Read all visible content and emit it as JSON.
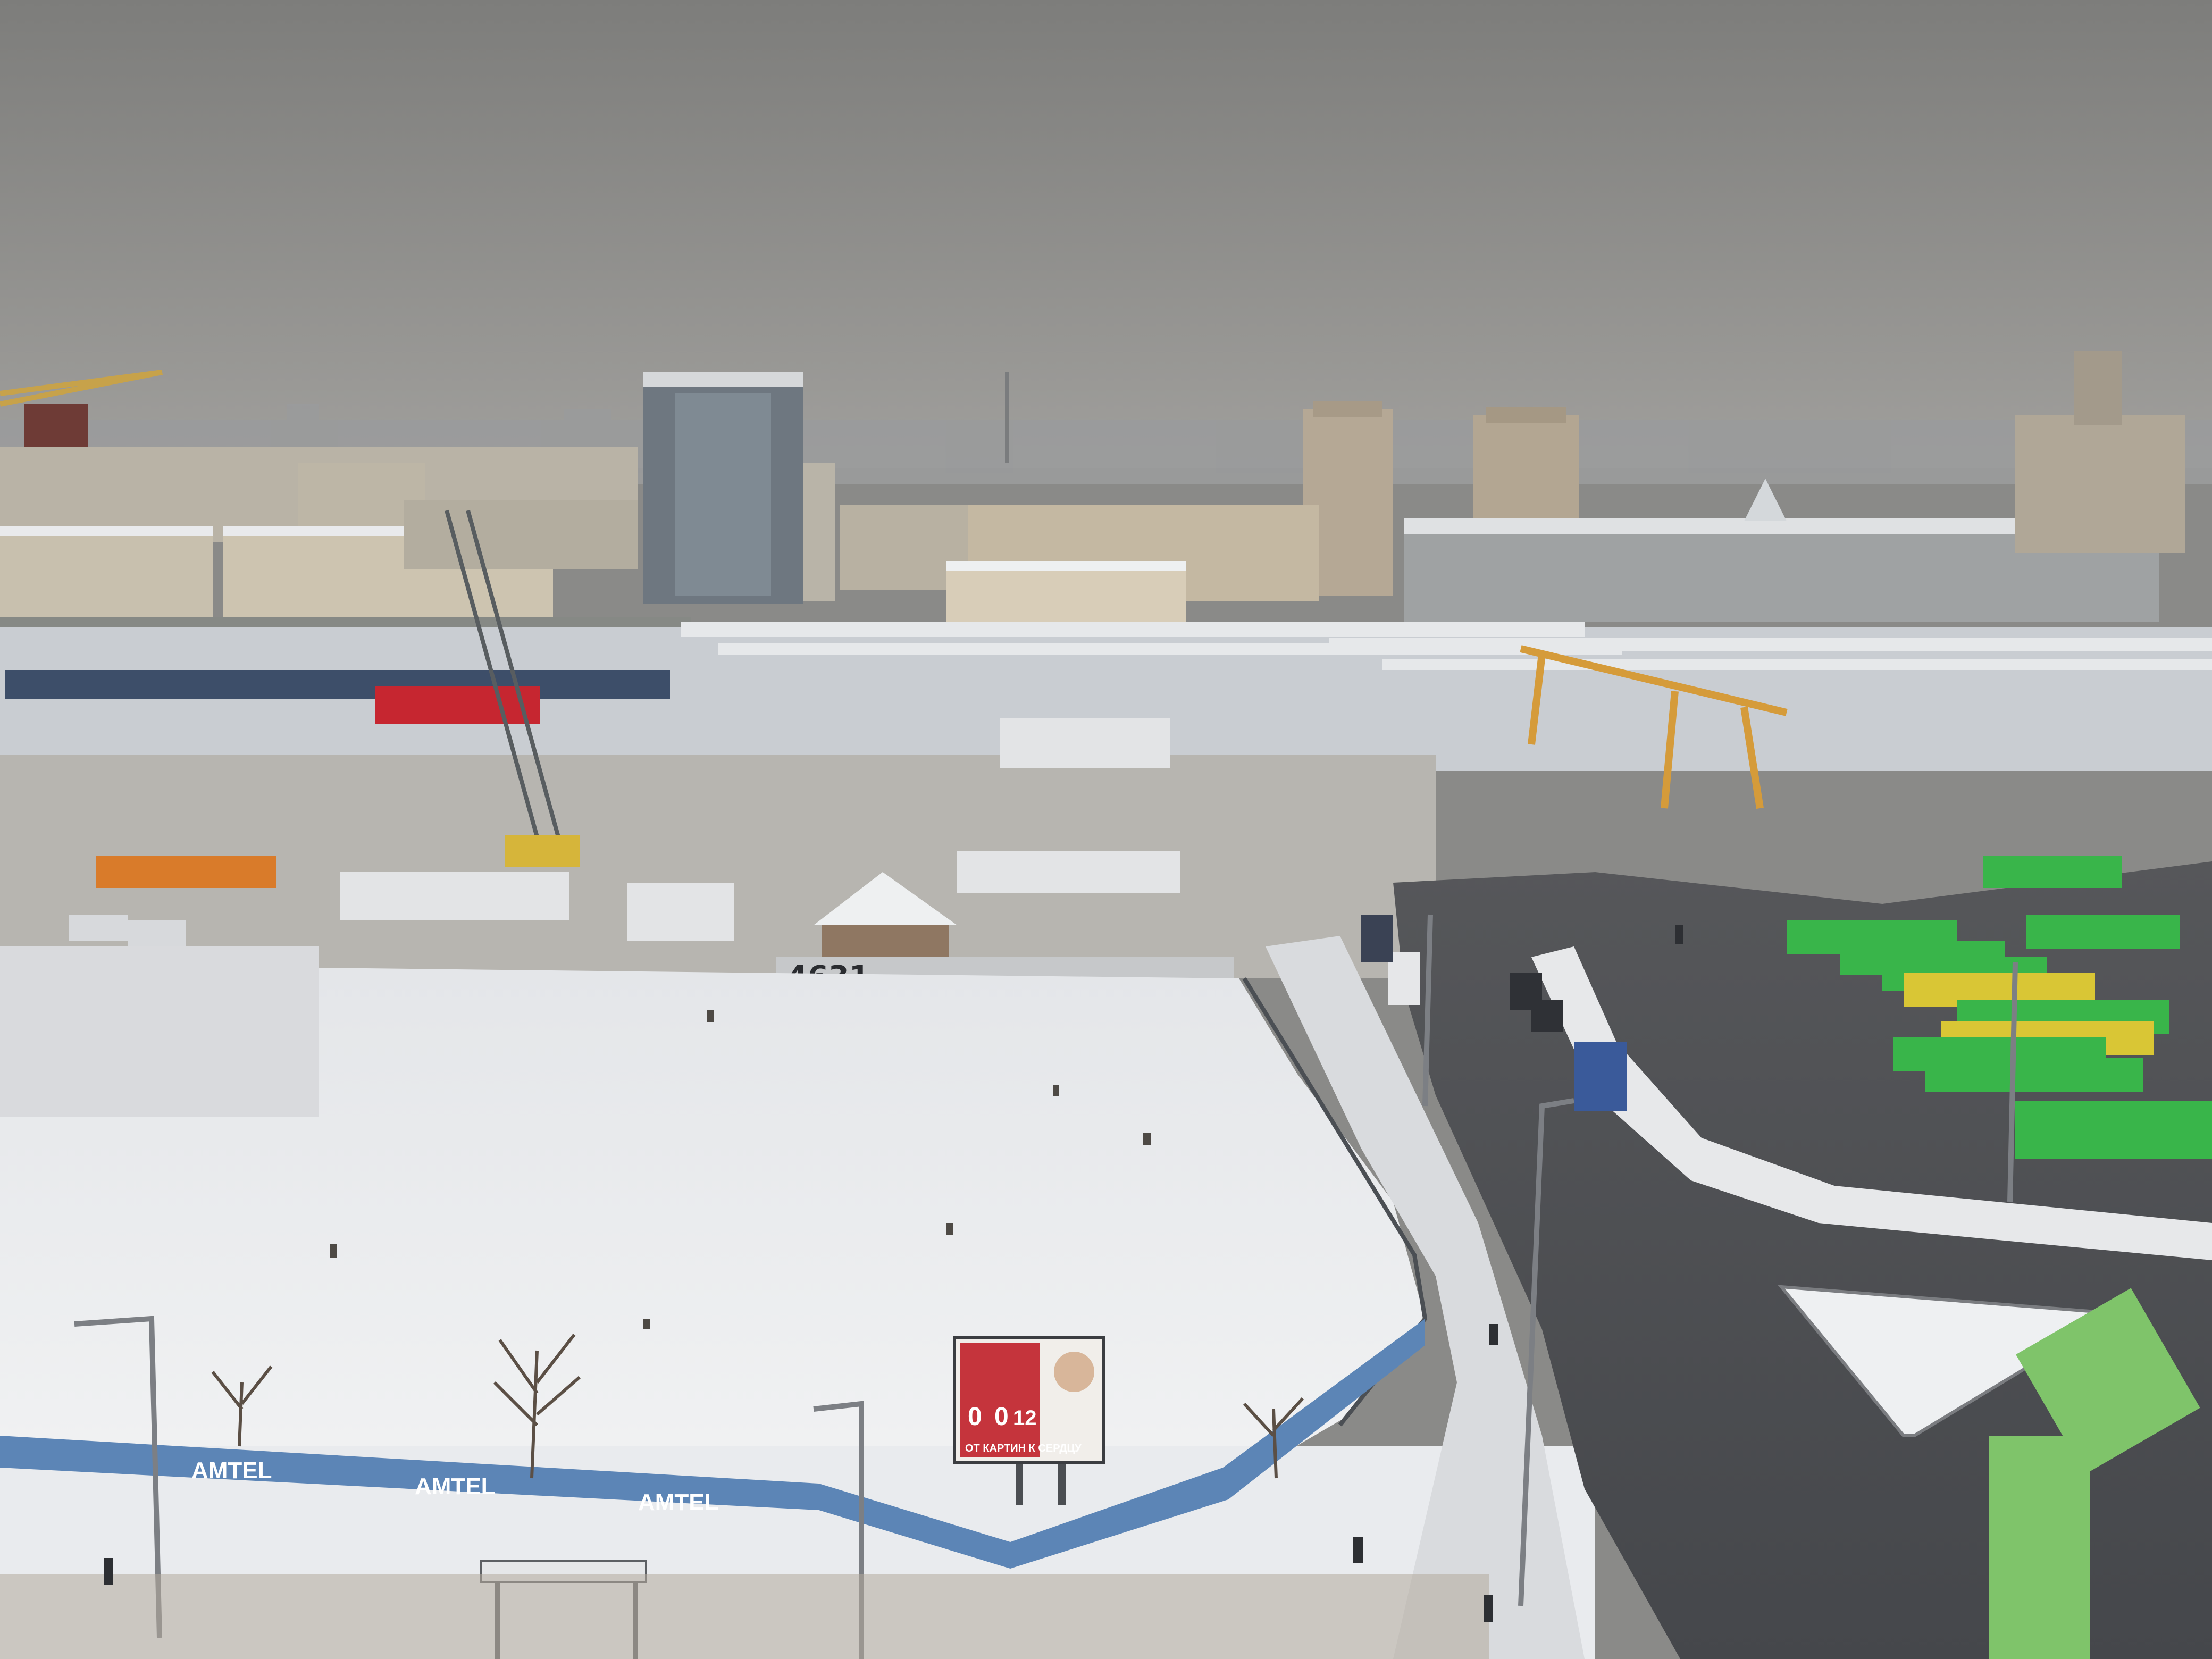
{
  "scene": {
    "kind": "aerial photograph",
    "season": "winter"
  },
  "signage": {
    "graffiti": "4631",
    "billboard_line_1": "OT КАРТИН К СЕРДЦУ",
    "billboard_digits": [
      "0",
      "0",
      "12"
    ],
    "fence_logo": "AMTEL"
  },
  "colors": {
    "sky": "#8f8f8d",
    "snow": "#eceeef",
    "asphalt": "#4d4f53",
    "bus_green": "#39b54a",
    "bus_yellow": "#d9c635",
    "locomotive_red": "#c62630",
    "crane_orange": "#d59b3a",
    "fence_blue": "#5c85b6"
  }
}
